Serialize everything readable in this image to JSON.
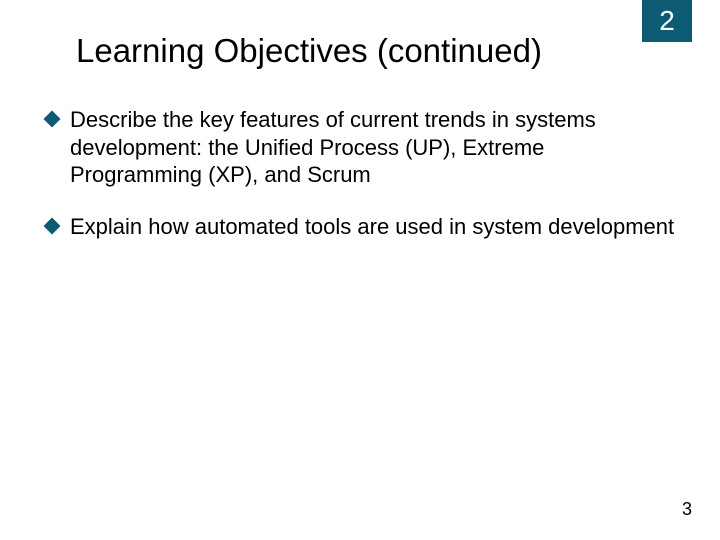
{
  "chapter_number": "2",
  "title": "Learning Objectives (continued)",
  "bullets": [
    "Describe the key features of current trends in systems development: the Unified Process (UP), Extreme Programming (XP), and Scrum",
    "Explain how automated tools are used in system development"
  ],
  "page_number": "3",
  "colors": {
    "accent": "#0d5b73"
  }
}
